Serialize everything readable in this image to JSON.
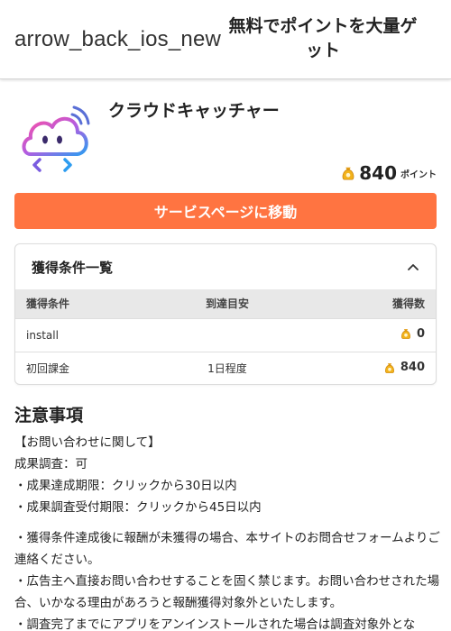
{
  "header": {
    "back_label": "arrow_back_ios_new",
    "title": "無料でポイントを大量ゲット"
  },
  "app": {
    "name": "クラウドキャッチャー",
    "icon": "cloud-catcher-logo",
    "points": "840",
    "points_unit": "ポイント"
  },
  "service_button": "サービスページに移動",
  "conditions": {
    "title": "獲得条件一覧",
    "columns": [
      "獲得条件",
      "到達目安",
      "獲得数"
    ],
    "rows": [
      {
        "condition": "install",
        "eta": "",
        "points": "0"
      },
      {
        "condition": "初回課金",
        "eta": "1日程度",
        "points": "840"
      }
    ]
  },
  "notes": {
    "title": "注意事項",
    "lines": [
      "【お問い合わせに関して】",
      "成果調査：可",
      "・成果達成期限：クリックから30日以内",
      "・成果調査受付期限：クリックから45日以内",
      "・獲得条件達成後に報酬が未獲得の場合、本サイトのお問合せフォームよりご連絡ください。",
      "・広告主へ直接お問い合わせすることを固く禁じます。お問い合わせされた場合、いかなる理由があろうと報酬獲得対象外といたします。",
      "・調査完了までにアプリをアンインストールされた場合は調査対象外とな"
    ]
  },
  "colors": {
    "accent": "#ff7441",
    "table_header": "#e8e8e8",
    "coin": "#f2b21b"
  }
}
